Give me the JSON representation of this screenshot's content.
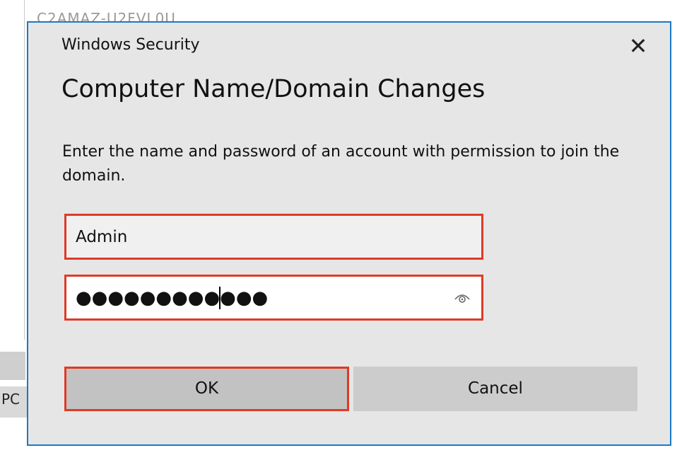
{
  "background": {
    "partial_text": "C2AMAZ-U2FVL0U",
    "side_label": "PC"
  },
  "dialog": {
    "caption": "Windows Security",
    "heading": "Computer Name/Domain Changes",
    "description": "Enter the name and password of an account with permission to join the domain.",
    "username": {
      "value": "Admin"
    },
    "password": {
      "masked_value": "●●●●●●●●●●●●"
    },
    "ok_label": "OK",
    "cancel_label": "Cancel",
    "close_glyph": "✕"
  },
  "colors": {
    "dialog_border": "#1979ca",
    "highlight": "#e03a24",
    "dialog_bg": "#e6e6e6"
  }
}
